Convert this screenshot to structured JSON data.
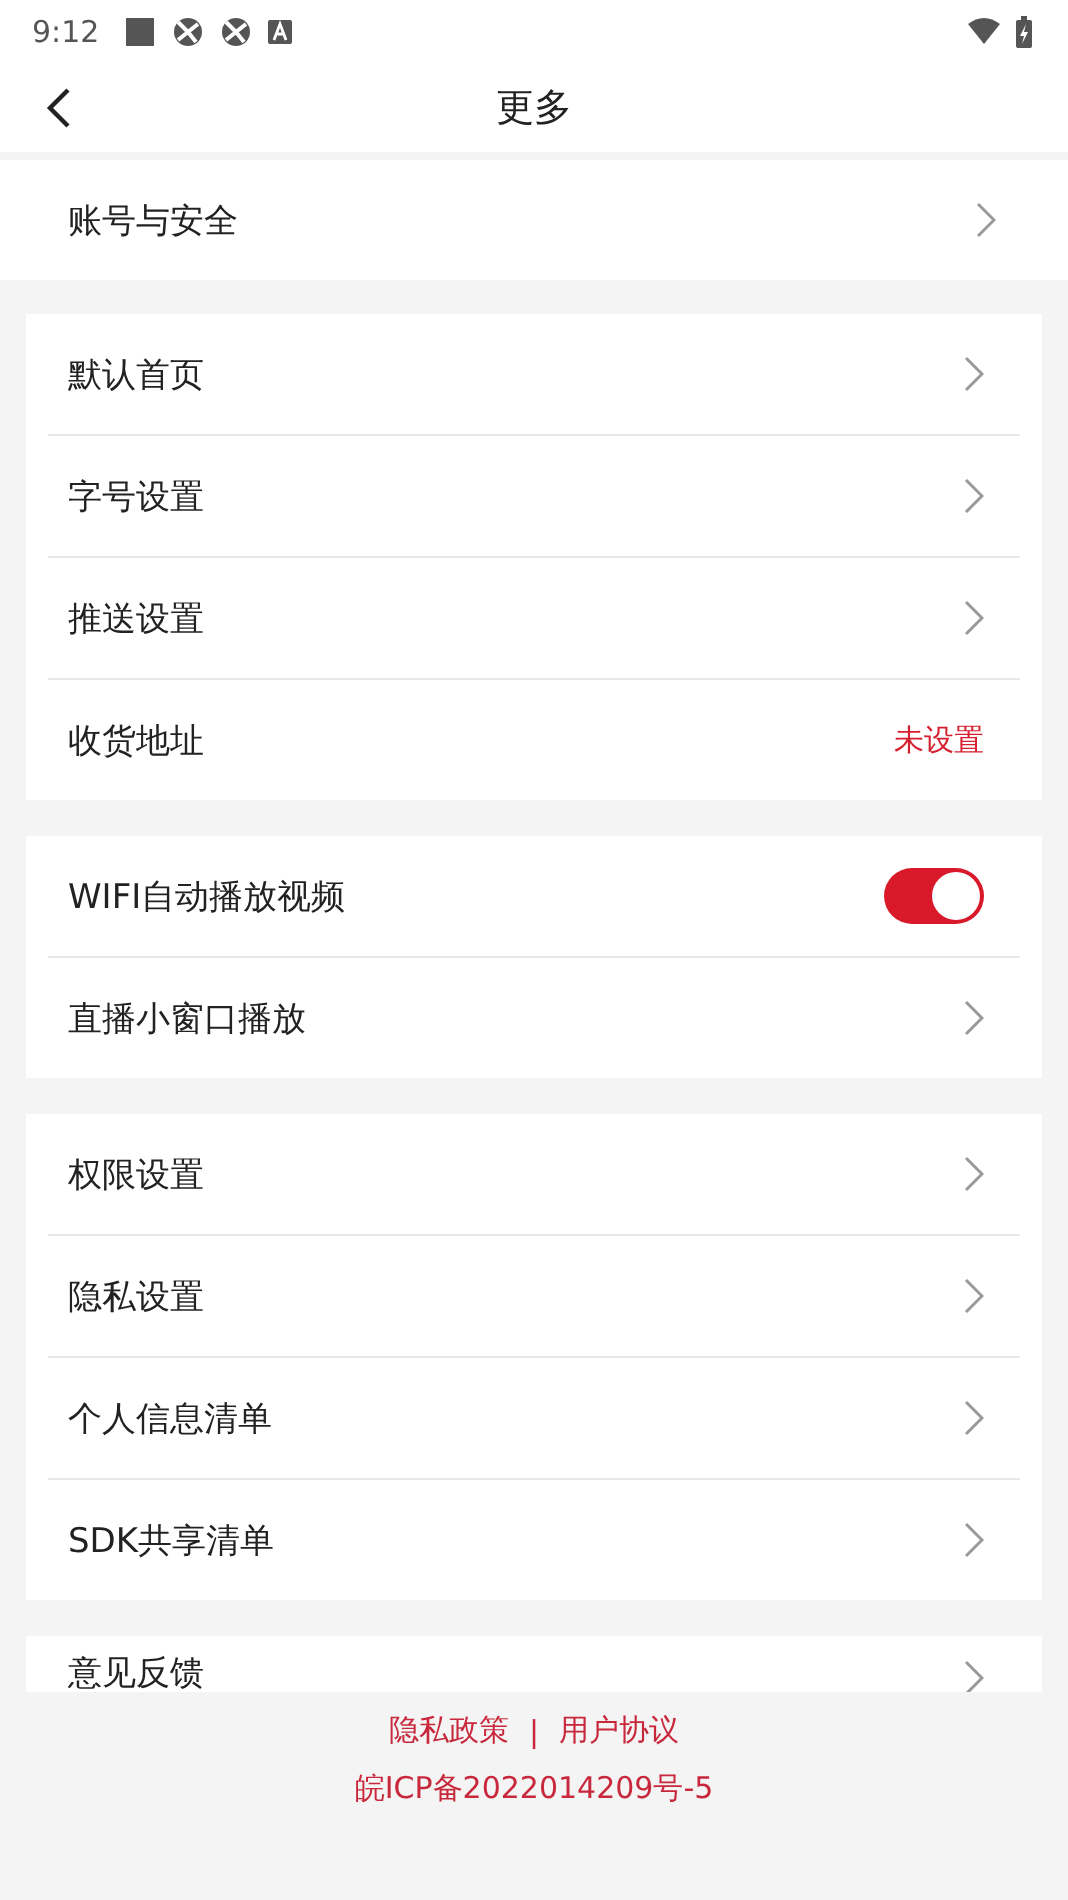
{
  "status_bar": {
    "time": "9:12"
  },
  "header": {
    "title": "更多"
  },
  "account": {
    "label": "账号与安全"
  },
  "groups": [
    {
      "items": [
        {
          "kind": "link",
          "label": "默认首页"
        },
        {
          "kind": "link",
          "label": "字号设置"
        },
        {
          "kind": "link",
          "label": "推送设置"
        },
        {
          "kind": "value",
          "label": "收货地址",
          "value": "未设置"
        }
      ]
    },
    {
      "items": [
        {
          "kind": "toggle",
          "label": "WIFI自动播放视频",
          "on": true
        },
        {
          "kind": "link",
          "label": "直播小窗口播放"
        }
      ]
    },
    {
      "items": [
        {
          "kind": "link",
          "label": "权限设置"
        },
        {
          "kind": "link",
          "label": "隐私设置"
        },
        {
          "kind": "link",
          "label": "个人信息清单"
        },
        {
          "kind": "link",
          "label": "SDK共享清单"
        }
      ]
    },
    {
      "items": [
        {
          "kind": "link",
          "label": "意见反馈"
        }
      ]
    }
  ],
  "footer": {
    "links": [
      "隐私政策",
      "用户协议"
    ],
    "separator": "|",
    "icp": "皖ICP备2022014209号-5"
  }
}
